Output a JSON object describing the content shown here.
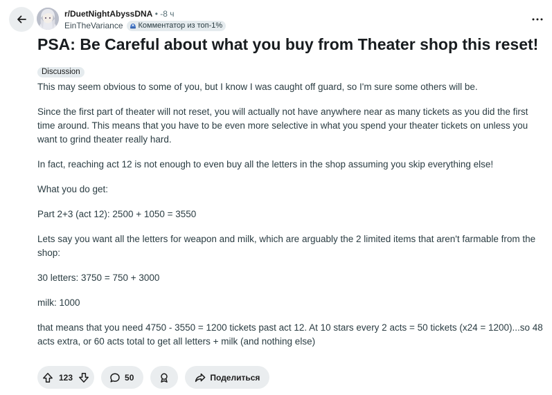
{
  "header": {
    "subreddit": "r/DuetNightAbyssDNA",
    "time": "• -8 ч",
    "author": "EinTheVariance",
    "user_flair": "Комментатор из топ-1%"
  },
  "post": {
    "title": "PSA: Be Careful about what you buy from Theater shop this reset!",
    "flair": "Discussion",
    "paragraphs": [
      "This may seem obvious to some of you, but I know I was caught off guard, so I'm sure some others will be.",
      "Since the first part of theater will not reset, you will actually not have anywhere near as many tickets as you did the first time around. This means that you have to be even more selective in what you spend your theater tickets on unless you want to grind theater really hard.",
      "In fact, reaching act 12 is not enough to even buy all the letters in the shop assuming you skip everything else!",
      "What you do get:",
      "Part 2+3 (act 12): 2500 + 1050 = 3550",
      "Lets say you want all the letters for weapon and milk, which are arguably the 2 limited items that aren't farmable from the shop:",
      "30 letters: 3750 = 750 + 3000",
      "milk: 1000",
      "that means that you need 4750 - 3550 = 1200 tickets past act 12. At 10 stars every 2 acts = 50 tickets (x24 = 1200)...so 48 acts extra, or 60 acts total to get all letters + milk (and nothing else)"
    ]
  },
  "actions": {
    "votes": "123",
    "comments": "50",
    "share_label": "Поделиться"
  },
  "icons": {
    "back": "arrow-left-icon",
    "more": "more-horizontal-icon",
    "upvote": "upvote-arrow-icon",
    "downvote": "downvote-arrow-icon",
    "comment": "comment-bubble-icon",
    "award": "award-icon",
    "share": "share-arrow-icon"
  },
  "colors": {
    "pill_bg": "#eaedef",
    "flair_bg": "#e5ebee",
    "text_primary": "#1c1c1c",
    "text_body": "#2a3c42"
  }
}
